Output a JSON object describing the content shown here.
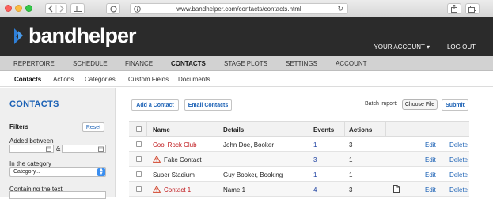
{
  "browser": {
    "url": "www.bandhelper.com/contacts/contacts.html",
    "reload_icon": "reload-icon"
  },
  "header": {
    "logo_text": "bandhelper",
    "account_label": "YOUR ACCOUNT ▾",
    "logout_label": "LOG OUT"
  },
  "main_nav": [
    "REPERTOIRE",
    "SCHEDULE",
    "FINANCE",
    "CONTACTS",
    "STAGE PLOTS",
    "SETTINGS",
    "ACCOUNT"
  ],
  "main_nav_active": "CONTACTS",
  "sub_nav": [
    "Contacts",
    "Actions",
    "Categories",
    "Custom Fields",
    "Documents"
  ],
  "sub_nav_active": "Contacts",
  "sidebar": {
    "title": "CONTACTS",
    "filters_label": "Filters",
    "reset_label": "Reset",
    "added_between_label": "Added between",
    "and_label": "&",
    "category_label": "In the category",
    "category_value": "Category...",
    "text_label": "Containing the text"
  },
  "toolbar": {
    "add_contact": "Add a Contact",
    "email_contacts": "Email Contacts",
    "import_label": "Batch import:",
    "choose_file": "Choose File",
    "submit": "Submit"
  },
  "table": {
    "headers": [
      "Name",
      "Details",
      "Events",
      "Actions"
    ],
    "rows": [
      {
        "name": "Cool Rock Club",
        "details": "John Doe, Booker",
        "events": "1",
        "actions": "3",
        "edit": "Edit",
        "delete": "Delete"
      },
      {
        "name": "Fake Contact",
        "details": "",
        "events": "3",
        "actions": "1",
        "edit": "Edit",
        "delete": "Delete"
      },
      {
        "name": "Super Stadium",
        "details": "Guy Booker, Booking",
        "events": "1",
        "actions": "1",
        "edit": "Edit",
        "delete": "Delete"
      },
      {
        "name": "Contact 1",
        "details": "Name 1",
        "events": "4",
        "actions": "3",
        "edit": "Edit",
        "delete": "Delete"
      }
    ]
  },
  "colors": {
    "brand_blue": "#1b61b5",
    "header_bg": "#2b2b2b",
    "warning_red": "#c0191d"
  }
}
